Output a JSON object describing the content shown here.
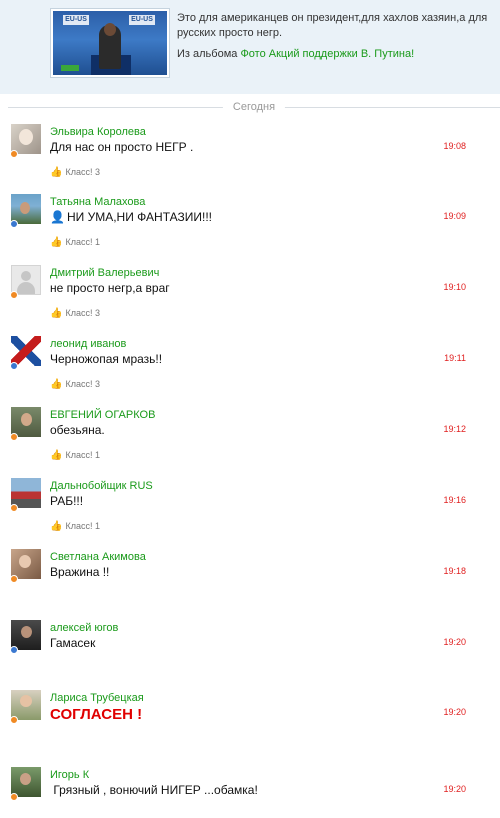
{
  "header": {
    "photo_labels": {
      "left": "EU-US",
      "right": "EU-US"
    },
    "caption": "Это для американцев он президент,для хахлов хазяин,а для русских просто негр.",
    "album_prefix": "Из альбома",
    "album_link": "Фото Акций поддержки В. Путина!"
  },
  "divider": {
    "label": "Сегодня"
  },
  "comments": [
    {
      "name": "Эльвира Королева",
      "text": "Для нас он просто НЕГР .",
      "time": "19:08",
      "likes": "Класс! 3"
    },
    {
      "name": "Татьяна Малахова",
      "text": "НИ УМА,НИ ФАНТАЗИИ!!!",
      "time": "19:09",
      "likes": "Класс! 1"
    },
    {
      "name": "Дмитрий Валерьевич",
      "text": "не просто негр,а враг",
      "time": "19:10",
      "likes": "Класс! 3"
    },
    {
      "name": "леонид иванов",
      "text": "Черножопая мразь!!",
      "time": "19:11",
      "likes": "Класс! 3"
    },
    {
      "name": "ЕВГЕНИЙ ОГАРКОВ",
      "text": "обезьяна.",
      "time": "19:12",
      "likes": "Класс! 1"
    },
    {
      "name": "Дальнобойщик RUS",
      "text": "РАБ!!!",
      "time": "19:16",
      "likes": "Класс! 1"
    },
    {
      "name": "Светлана Акимова",
      "text": "Вражина !!",
      "time": "19:18",
      "likes": ""
    },
    {
      "name": "алексей югов",
      "text": "Гамасек",
      "time": "19:20",
      "likes": ""
    },
    {
      "name": "Лариса Трубецкая",
      "text": "СОГЛАСЕН !",
      "time": "19:20",
      "likes": ""
    },
    {
      "name": "Игорь К",
      "text": " Грязный , вонючий НИГЕР ...обамка!",
      "time": "19:20",
      "likes": ""
    }
  ],
  "colors": {
    "link_green": "#1a9a1a",
    "time_red": "#e02020",
    "header_bg": "#eaf2f8",
    "status_orange": "#f08a24",
    "status_blue": "#3a78d0"
  },
  "icons": {
    "like": "thumbs-up-icon",
    "inline_user": "user-silhouette-icon"
  }
}
